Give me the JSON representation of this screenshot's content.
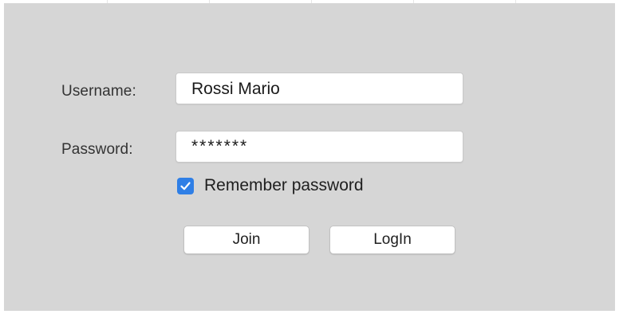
{
  "form": {
    "username_label": "Username:",
    "username_value": "Rossi Mario",
    "password_label": "Password:",
    "password_value": "*******",
    "remember_checked": true,
    "remember_label": "Remember password"
  },
  "buttons": {
    "join_label": "Join",
    "login_label": "LogIn"
  },
  "colors": {
    "panel_background": "#d6d6d6",
    "checkbox_accent": "#2f7fe6"
  }
}
